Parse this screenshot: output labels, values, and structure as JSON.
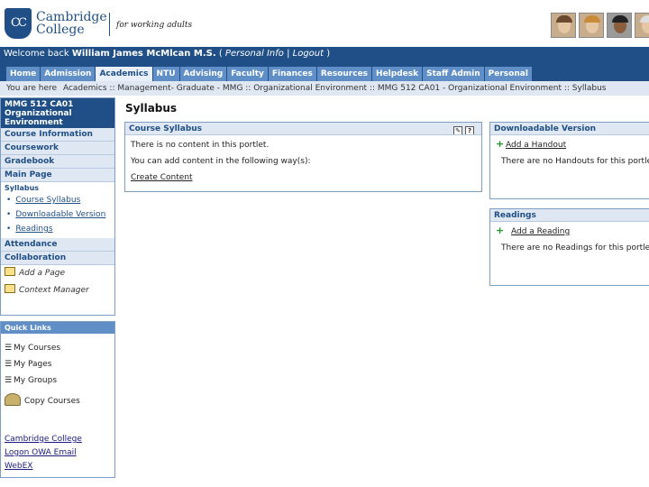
{
  "header": {
    "logo_seal": "CC",
    "logo_line1": "Cambridge",
    "logo_line2": "College",
    "tagline": "for working adults",
    "avatars": [
      "person-photo",
      "person-photo",
      "person-photo",
      "person-photo"
    ]
  },
  "welcome": {
    "prefix": "Welcome back ",
    "user_name": "William James McMlcan M.S.",
    "open": " ( ",
    "personal_info": "Personal Info",
    "sep": " | ",
    "logout": "Logout",
    "close": " )"
  },
  "tabs": [
    {
      "label": "Home"
    },
    {
      "label": "Admission"
    },
    {
      "label": "Academics",
      "active": true
    },
    {
      "label": "NTU"
    },
    {
      "label": "Advising"
    },
    {
      "label": "Faculty"
    },
    {
      "label": "Finances"
    },
    {
      "label": "Resources"
    },
    {
      "label": "Helpdesk"
    },
    {
      "label": "Staff Admin"
    },
    {
      "label": "Personal"
    }
  ],
  "breadcrumb": {
    "label": "You are here",
    "path": "Academics :: Management- Graduate - MMG :: Organizational Environment :: MMG 512 CA01 - Organizational Environment :: Syllabus"
  },
  "sidebar": {
    "course_title": "MMG 512 CA01 Organizational Environment",
    "nav": [
      "Course Information",
      "Coursework",
      "Gradebook",
      "Main Page"
    ],
    "section_label": "Syllabus",
    "section_links": [
      "Course Syllabus",
      "Downloadable Version",
      "Readings"
    ],
    "nav2": [
      "Attendance",
      "Collaboration"
    ],
    "tools": [
      "Add a Page",
      "Context Manager"
    ]
  },
  "quick_links": {
    "header": "Quick Links",
    "items": [
      "My Courses",
      "My Pages",
      "My Groups"
    ],
    "copy_courses": "Copy Courses",
    "external": [
      "Cambridge College",
      "Logon OWA Email",
      "WebEX"
    ]
  },
  "main": {
    "title": "Syllabus",
    "course_syllabus": {
      "header": "Course Syllabus",
      "line1": "There is no content in this portlet.",
      "line2": "You can add content in the following way(s):",
      "link": "Create Content",
      "icons": [
        "edit-icon",
        "help-icon"
      ]
    },
    "downloadable": {
      "header": "Downloadable Version",
      "add_link": "Add a Handout",
      "empty": "There are no Handouts for this portlet."
    },
    "readings": {
      "header": "Readings",
      "add_link": "Add a Reading",
      "empty": "There are no Readings for this portlet."
    }
  },
  "colors": {
    "brand_blue": "#1f4f86",
    "tab_blue": "#5f8fc6",
    "light_blue": "#dfe7f2",
    "add_green": "#1c9a2a"
  }
}
